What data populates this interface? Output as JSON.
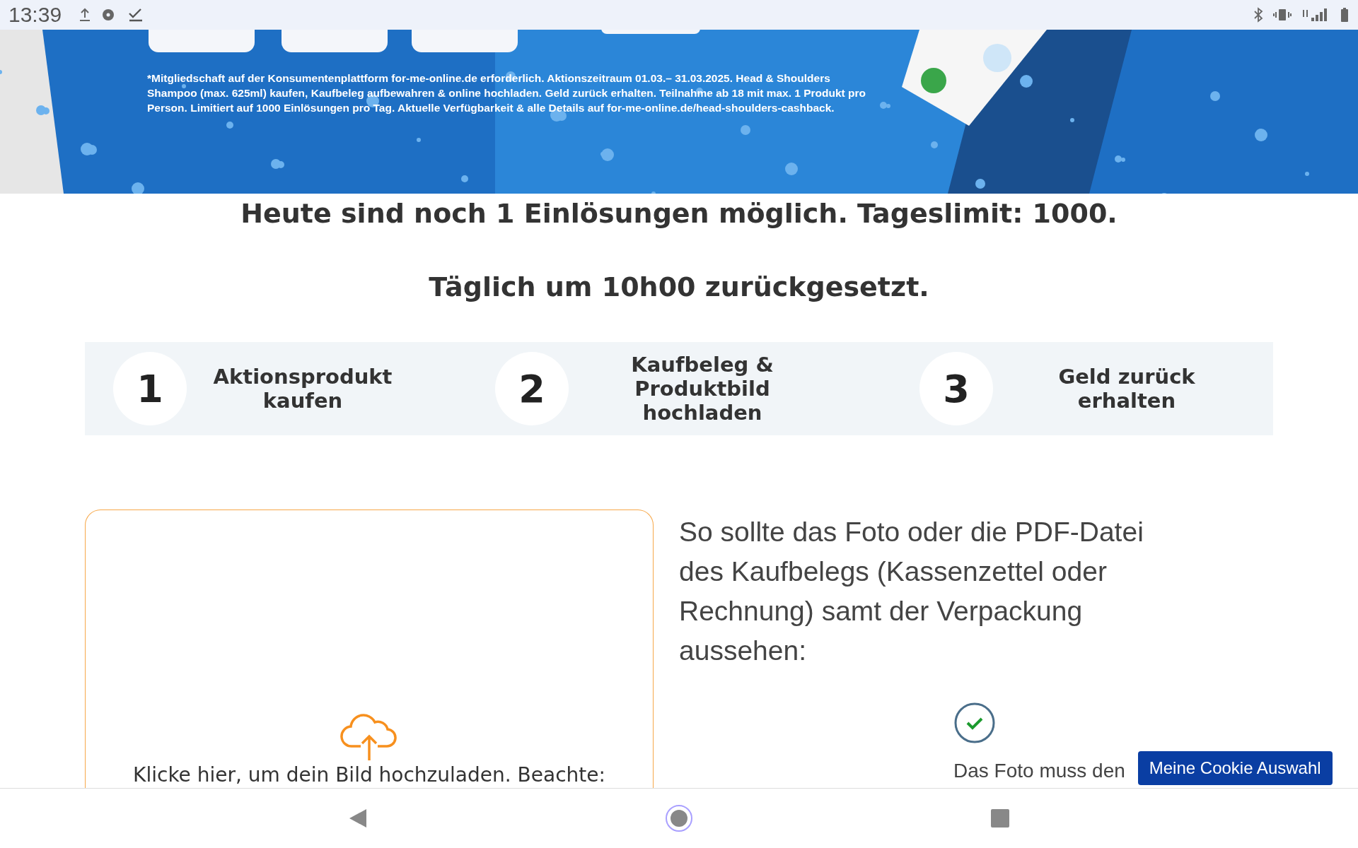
{
  "status_bar": {
    "time": "13:39"
  },
  "banner": {
    "fine_print": "*Mitgliedschaft auf der Konsumentenplattform for-me-online.de erforderlich. Aktionszeitraum 01.03.– 31.03.2025. Head & Shoulders Shampoo (max. 625ml) kaufen, Kaufbeleg aufbewahren & online hochladen. Geld zurück erhalten. Teilnahme ab 18 mit max. 1 Produkt pro Person. Limitiert auf 1000 Einlösungen pro Tag. Aktuelle Verfügbarkeit & alle Details auf for-me-online.de/head-shoulders-cashback."
  },
  "headings": [
    "Heute sind noch 1 Einlösungen möglich. Tageslimit: 1000.",
    "Täglich um 10h00 zurückgesetzt."
  ],
  "steps": [
    {
      "number": "1",
      "label": "Aktionsprodukt kaufen"
    },
    {
      "number": "2",
      "label": "Kaufbeleg & Produktbild hochladen"
    },
    {
      "number": "3",
      "label": "Geld zurück erhalten"
    }
  ],
  "upload": {
    "text": "Klicke hier, um dein Bild hochzuladen. Beachte:"
  },
  "instructions": {
    "text": "So sollte das Foto oder die PDF-Datei des Kaufbelegs (Kassenzettel oder Rechnung) samt der Verpackung aussehen:",
    "check_text": "Das Foto muss den"
  },
  "cookie_button": "Meine Cookie Auswahl"
}
